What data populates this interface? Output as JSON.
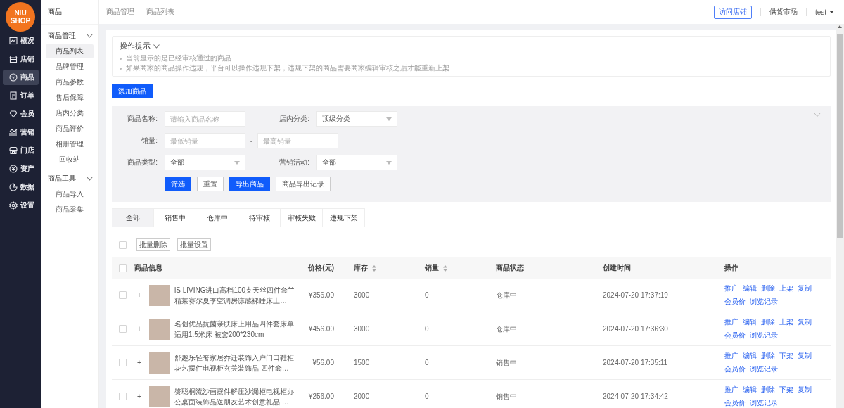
{
  "logo": {
    "line1": "NiU",
    "line2": "SHOP"
  },
  "nav": [
    {
      "label": "概况",
      "selected": false
    },
    {
      "label": "店铺",
      "selected": false
    },
    {
      "label": "商品",
      "selected": true
    },
    {
      "label": "订单",
      "selected": false
    },
    {
      "label": "会员",
      "selected": false
    },
    {
      "label": "营销",
      "selected": false
    },
    {
      "label": "门店",
      "selected": false
    },
    {
      "label": "资产",
      "selected": false
    },
    {
      "label": "数据",
      "selected": false
    },
    {
      "label": "设置",
      "selected": false
    }
  ],
  "submenu": {
    "title": "商品",
    "groups": [
      {
        "label": "商品管理",
        "expanded": true,
        "children": [
          {
            "label": "商品列表",
            "selected": true
          },
          {
            "label": "品牌管理",
            "selected": false
          },
          {
            "label": "商品参数",
            "selected": false
          },
          {
            "label": "售后保障",
            "selected": false
          },
          {
            "label": "店内分类",
            "selected": false
          },
          {
            "label": "商品评价",
            "selected": false
          },
          {
            "label": "相册管理",
            "selected": false
          },
          {
            "label": "回收站",
            "selected": false
          }
        ]
      },
      {
        "label": "商品工具",
        "expanded": true,
        "children": [
          {
            "label": "商品导入",
            "selected": false
          },
          {
            "label": "商品采集",
            "selected": false
          }
        ]
      }
    ]
  },
  "breadcrumb": {
    "items": [
      "商品管理",
      "商品列表"
    ],
    "separator": "-"
  },
  "header": {
    "visit_store": "访问店铺",
    "market": "供货市场",
    "user": "test"
  },
  "tips": {
    "title": "操作提示",
    "expanded": true,
    "items": [
      "当前显示的是已经审核通过的商品",
      "如果商家的商品操作违规，平台可以操作违规下架，违规下架的商品需要商家编辑审核之后才能重新上架"
    ]
  },
  "add_button": "添加商品",
  "filters": {
    "rows": [
      {
        "kind": "pair",
        "fields": [
          {
            "label": "商品名称:",
            "kind": "input",
            "placeholder": "请输入商品名称"
          },
          {
            "label": "店内分类:",
            "kind": "select",
            "value": "顶级分类"
          }
        ]
      },
      {
        "kind": "range",
        "label": "销量:",
        "separator": "-",
        "min_placeholder": "最低销量",
        "max_placeholder": "最高销量"
      },
      {
        "kind": "pair",
        "fields": [
          {
            "label": "商品类型:",
            "kind": "select",
            "value": "全部"
          },
          {
            "label": "营销活动:",
            "kind": "select",
            "value": "全部"
          }
        ]
      }
    ],
    "buttons": [
      {
        "label": "筛选",
        "kind": "primary"
      },
      {
        "label": "重置",
        "kind": "default"
      },
      {
        "label": "导出商品",
        "kind": "primary"
      },
      {
        "label": "商品导出记录",
        "kind": "default"
      }
    ]
  },
  "tabs": [
    {
      "label": "全部",
      "selected": true
    },
    {
      "label": "销售中",
      "selected": false
    },
    {
      "label": "仓库中",
      "selected": false
    },
    {
      "label": "待审核",
      "selected": false
    },
    {
      "label": "审核失败",
      "selected": false
    },
    {
      "label": "违规下架",
      "selected": false
    }
  ],
  "batch": {
    "checked": false,
    "buttons": [
      "批量删除",
      "批量设置"
    ]
  },
  "table": {
    "select_all_checked": false,
    "columns": [
      {
        "label": "商品信息",
        "sortable": false
      },
      {
        "label": "价格(元)",
        "sortable": false
      },
      {
        "label": "库存",
        "sortable": true
      },
      {
        "label": "销量",
        "sortable": true
      },
      {
        "label": "商品状态",
        "sortable": false
      },
      {
        "label": "创建时间",
        "sortable": false
      },
      {
        "label": "操作",
        "sortable": false
      }
    ],
    "rows": [
      {
        "checked": false,
        "expand": "+",
        "name": "iS LIVING进口高档100支天丝四件套兰精莱赛尔夏季空调房凉感裸睡床上…",
        "price": "¥356.00",
        "stock": "3000",
        "sales": "0",
        "status": "仓库中",
        "created": "2024-07-20 17:37:19",
        "actions": [
          "推广",
          "编辑",
          "删除",
          "上架",
          "复制",
          "会员价",
          "浏览记录"
        ]
      },
      {
        "checked": false,
        "expand": "+",
        "name": "名创优品抗菌亲肤床上用品四件套床单适用1.5米床 被套200*230cm",
        "price": "¥456.00",
        "stock": "3000",
        "sales": "0",
        "status": "仓库中",
        "created": "2024-07-20 17:36:30",
        "actions": [
          "推广",
          "编辑",
          "删除",
          "上架",
          "复制",
          "会员价",
          "浏览记录"
        ]
      },
      {
        "checked": false,
        "expand": "+",
        "name": "舒趣乐轻奢家居乔迁装饰入户门口鞋柜花艺摆件电视柜玄关装饰品 四件套…",
        "price": "¥56.00",
        "stock": "1500",
        "sales": "0",
        "status": "销售中",
        "created": "2024-07-20 17:35:11",
        "actions": [
          "推广",
          "编辑",
          "删除",
          "下架",
          "复制",
          "会员价",
          "浏览记录"
        ]
      },
      {
        "checked": false,
        "expand": "+",
        "name": "赞聪桐流沙画摆件解压沙漏柜电视柜办公桌面装饰品送朋友艺术创意礼品 …",
        "price": "¥256.00",
        "stock": "2000",
        "sales": "0",
        "status": "销售中",
        "created": "2024-07-20 17:34:42",
        "actions": [
          "推广",
          "编辑",
          "删除",
          "下架",
          "复制",
          "会员价",
          "浏览记录"
        ]
      }
    ]
  }
}
